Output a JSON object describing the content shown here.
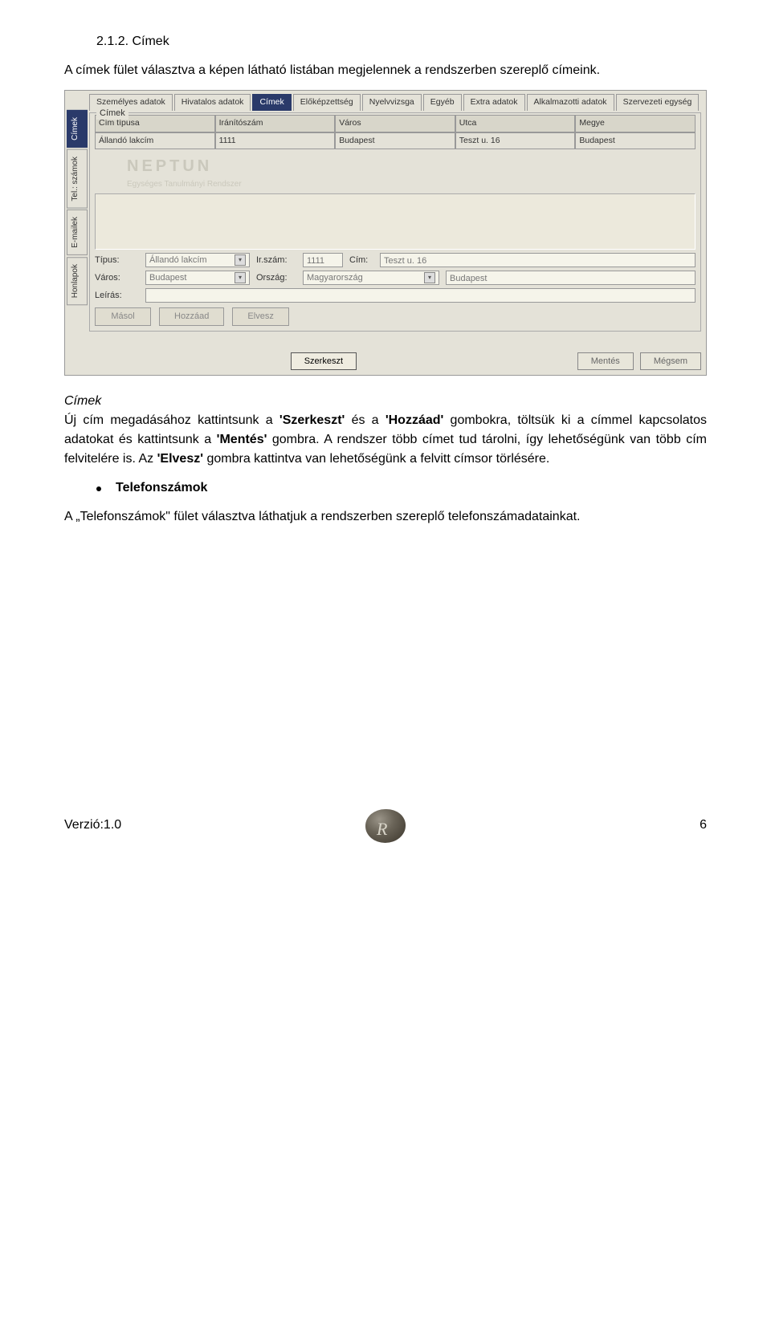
{
  "heading": "2.1.2. Címek",
  "intro": "A címek fület választva a képen látható listában megjelennek a rendszerben szereplő címeink.",
  "screenshot": {
    "top_tabs": [
      "Személyes adatok",
      "Hivatalos adatok",
      "Címek",
      "Előképzettség",
      "Nyelvvizsga",
      "Egyéb",
      "Extra adatok",
      "Alkalmazotti adatok",
      "Szervezeti egység"
    ],
    "top_active_index": 2,
    "side_tabs": [
      "Címek",
      "Tel.: számok",
      "E-mailek",
      "Honlapok"
    ],
    "side_active_index": 0,
    "group_title": "Címek",
    "grid_headers": [
      "Cím típusa",
      "Iránítószám",
      "Város",
      "Utca",
      "Megye"
    ],
    "grid_row": [
      "Állandó lakcím",
      "1111",
      "Budapest",
      "Teszt u. 16",
      "Budapest"
    ],
    "watermark": "NEPTUN",
    "watermark_sub": "Egységes Tanulmányi Rendszer",
    "form": {
      "tipus_label": "Típus:",
      "tipus_value": "Állandó lakcím",
      "irszam_label": "Ir.szám:",
      "irszam_value": "1111",
      "cim_label": "Cím:",
      "cim_value": "Teszt u. 16",
      "varos_label": "Város:",
      "varos_value": "Budapest",
      "orszag_label": "Ország:",
      "orszag_value": "Magyarország",
      "megye_value": "Budapest",
      "leiras_label": "Leírás:"
    },
    "action_buttons": [
      "Másol",
      "Hozzáad",
      "Elvesz"
    ],
    "bottom_buttons": {
      "szerkeszt": "Szerkeszt",
      "mentes": "Mentés",
      "megsem": "Mégsem"
    }
  },
  "cimek_heading": "Címek",
  "body1_parts": {
    "a": "Új cím megadásához kattintsunk a ",
    "b": "'Szerkeszt'",
    "c": " és a ",
    "d": "'Hozzáad'",
    "e": " gombokra, töltsük ki a címmel kapcsolatos adatokat és kattintsunk a ",
    "f": "'Mentés'",
    "g": " gombra. A rendszer több címet tud tárolni, így lehetőségünk van több cím felvitelére is. Az ",
    "h": "'Elvesz'",
    "i": " gombra kattintva van lehetőségünk a felvitt címsor törlésére."
  },
  "bullet": "Telefonszámok",
  "body2": "A „Telefonszámok\" fület választva láthatjuk a rendszerben szereplő telefonszámadatainkat.",
  "footer": {
    "version": "Verzió:1.0",
    "page": "6"
  }
}
